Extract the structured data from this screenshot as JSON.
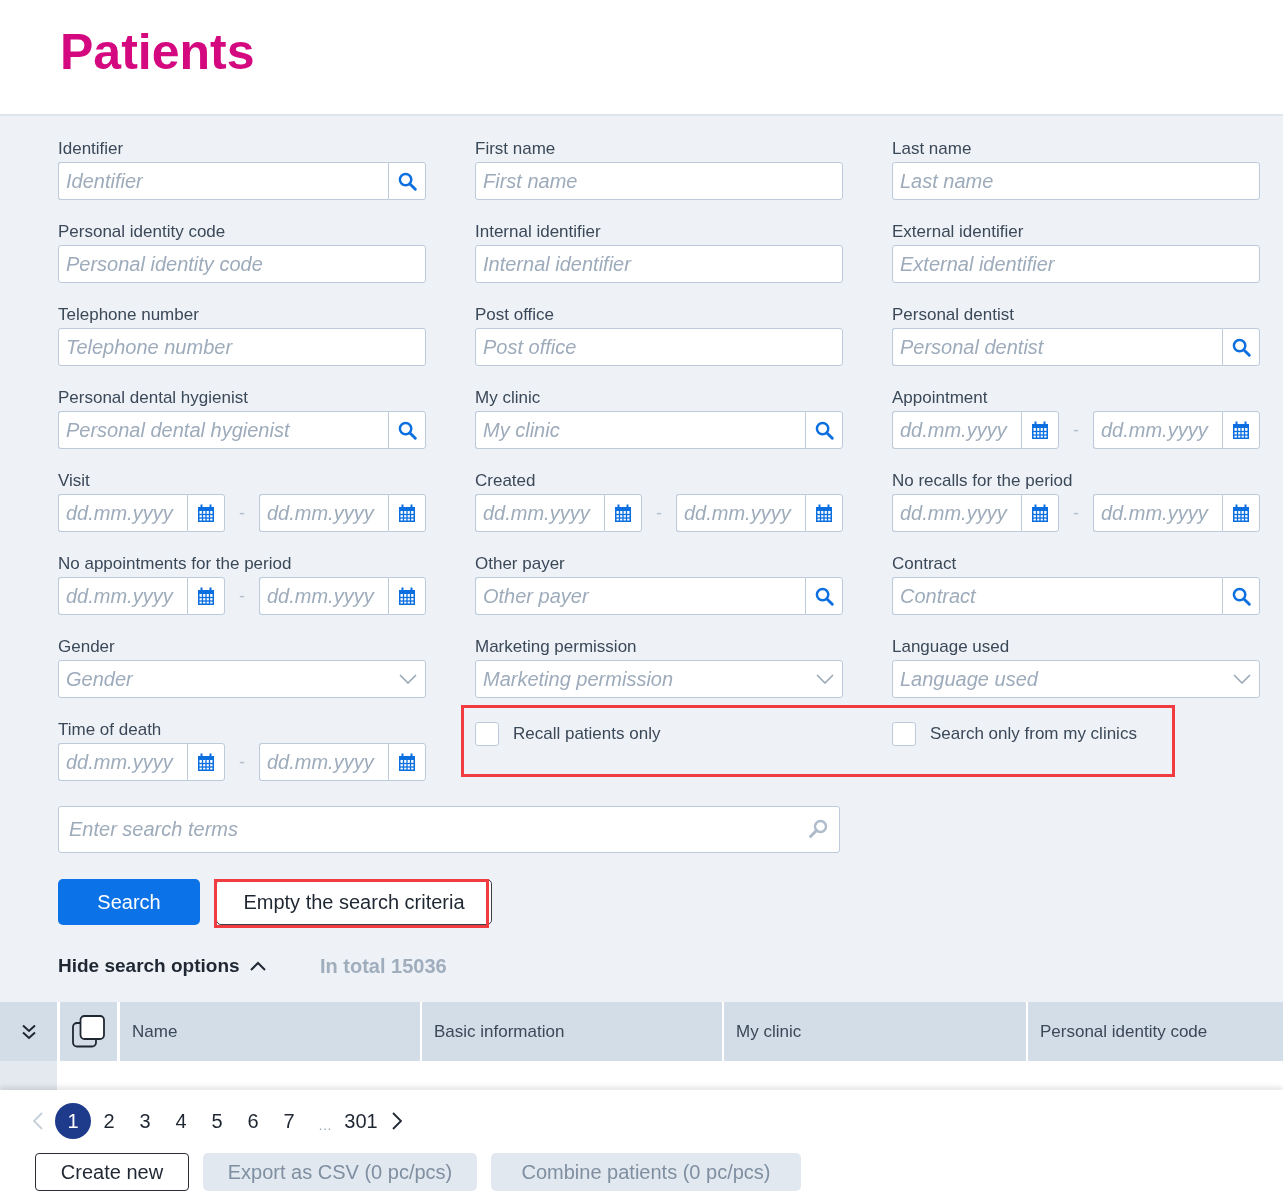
{
  "page": {
    "title": "Patients"
  },
  "search_form": {
    "fields": [
      {
        "label": "Identifier",
        "kind": "lookup",
        "placeholder": "Identifier"
      },
      {
        "label": "First name",
        "kind": "text",
        "placeholder": "First name"
      },
      {
        "label": "Last name",
        "kind": "text",
        "placeholder": "Last name"
      },
      {
        "label": "Personal identity code",
        "kind": "text",
        "placeholder": "Personal identity code"
      },
      {
        "label": "Internal identifier",
        "kind": "text",
        "placeholder": "Internal identifier"
      },
      {
        "label": "External identifier",
        "kind": "text",
        "placeholder": "External identifier"
      },
      {
        "label": "Telephone number",
        "kind": "text",
        "placeholder": "Telephone number"
      },
      {
        "label": "Post office",
        "kind": "text",
        "placeholder": "Post office"
      },
      {
        "label": "Personal dentist",
        "kind": "lookup",
        "placeholder": "Personal dentist"
      },
      {
        "label": "Personal dental hygienist",
        "kind": "lookup",
        "placeholder": "Personal dental hygienist"
      },
      {
        "label": "My clinic",
        "kind": "lookup",
        "placeholder": "My clinic"
      },
      {
        "label": "Appointment",
        "kind": "date_range",
        "from_placeholder": "dd.mm.yyyy",
        "separator": "-",
        "to_placeholder": "dd.mm.yyyy"
      },
      {
        "label": "Visit",
        "kind": "date_range",
        "from_placeholder": "dd.mm.yyyy",
        "separator": "-",
        "to_placeholder": "dd.mm.yyyy"
      },
      {
        "label": "Created",
        "kind": "date_range",
        "from_placeholder": "dd.mm.yyyy",
        "separator": "-",
        "to_placeholder": "dd.mm.yyyy"
      },
      {
        "label": "No recalls for the period",
        "kind": "date_range",
        "from_placeholder": "dd.mm.yyyy",
        "separator": "-",
        "to_placeholder": "dd.mm.yyyy"
      },
      {
        "label": "No appointments for the period",
        "kind": "date_range",
        "from_placeholder": "dd.mm.yyyy",
        "separator": "-",
        "to_placeholder": "dd.mm.yyyy"
      },
      {
        "label": "Other payer",
        "kind": "lookup",
        "placeholder": "Other payer"
      },
      {
        "label": "Contract",
        "kind": "lookup",
        "placeholder": "Contract"
      },
      {
        "label": "Gender",
        "kind": "select",
        "placeholder": "Gender"
      },
      {
        "label": "Marketing permission",
        "kind": "select",
        "placeholder": "Marketing permission"
      },
      {
        "label": "Language used",
        "kind": "select",
        "placeholder": "Language used"
      },
      {
        "label": "Time of death",
        "kind": "date_range",
        "from_placeholder": "dd.mm.yyyy",
        "separator": "-",
        "to_placeholder": "dd.mm.yyyy"
      }
    ],
    "checkboxes": {
      "highlighted": true,
      "items": [
        {
          "label": "Recall patients only",
          "checked": false
        },
        {
          "label": "Search only from my clinics",
          "checked": false
        }
      ]
    },
    "search_terms": {
      "placeholder": "Enter search terms"
    },
    "actions": [
      {
        "label": "Search",
        "kind": "primary",
        "highlighted": false
      },
      {
        "label": "Empty the search criteria",
        "kind": "secondary",
        "highlighted": true
      }
    ],
    "options_toggle": {
      "label": "Hide search options",
      "expanded": true
    },
    "total": "In total 15036"
  },
  "table": {
    "columns": [
      "Name",
      "Basic information",
      "My clinic",
      "Personal identity code"
    ]
  },
  "pagination": {
    "prev_disabled": true,
    "pages": [
      {
        "label": "1",
        "kind": "page",
        "selected": true
      },
      {
        "label": "2",
        "kind": "page",
        "selected": false
      },
      {
        "label": "3",
        "kind": "page",
        "selected": false
      },
      {
        "label": "4",
        "kind": "page",
        "selected": false
      },
      {
        "label": "5",
        "kind": "page",
        "selected": false
      },
      {
        "label": "6",
        "kind": "page",
        "selected": false
      },
      {
        "label": "7",
        "kind": "page",
        "selected": false
      },
      {
        "label": "…",
        "kind": "ellipsis",
        "selected": false
      },
      {
        "label": "301",
        "kind": "page",
        "selected": false
      }
    ],
    "next_disabled": false
  },
  "footer_buttons": [
    {
      "label": "Create new",
      "disabled": false
    },
    {
      "label": "Export as CSV (0 pc/pcs)",
      "disabled": true
    },
    {
      "label": "Combine patients (0 pc/pcs)",
      "disabled": true
    }
  ]
}
